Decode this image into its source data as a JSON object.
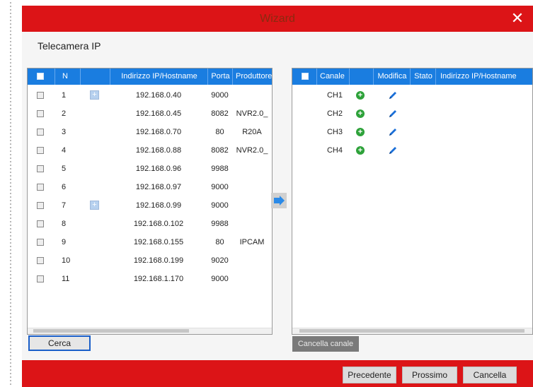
{
  "dialog": {
    "title": "Wizard",
    "close_glyph": "✕",
    "section_title": "Telecamera IP"
  },
  "left_table": {
    "columns": {
      "n": "N",
      "address": "Indirizzo IP/Hostname",
      "port": "Porta",
      "product": "Produttore"
    },
    "rows": [
      {
        "n": "1",
        "ip": "192.168.0.40",
        "port": "9000",
        "product": "",
        "addable": true
      },
      {
        "n": "2",
        "ip": "192.168.0.45",
        "port": "8082",
        "product": "NVR2.0_",
        "addable": false
      },
      {
        "n": "3",
        "ip": "192.168.0.70",
        "port": "80",
        "product": "R20A",
        "addable": false
      },
      {
        "n": "4",
        "ip": "192.168.0.88",
        "port": "8082",
        "product": "NVR2.0_",
        "addable": false
      },
      {
        "n": "5",
        "ip": "192.168.0.96",
        "port": "9988",
        "product": "",
        "addable": false
      },
      {
        "n": "6",
        "ip": "192.168.0.97",
        "port": "9000",
        "product": "",
        "addable": false
      },
      {
        "n": "7",
        "ip": "192.168.0.99",
        "port": "9000",
        "product": "",
        "addable": true
      },
      {
        "n": "8",
        "ip": "192.168.0.102",
        "port": "9988",
        "product": "",
        "addable": false
      },
      {
        "n": "9",
        "ip": "192.168.0.155",
        "port": "80",
        "product": "IPCAM",
        "addable": false
      },
      {
        "n": "10",
        "ip": "192.168.0.199",
        "port": "9020",
        "product": "",
        "addable": false
      },
      {
        "n": "11",
        "ip": "192.168.1.170",
        "port": "9000",
        "product": "",
        "addable": false
      }
    ]
  },
  "right_table": {
    "columns": {
      "channel": "Canale",
      "edit": "Modifica",
      "status": "Stato",
      "address": "Indirizzo IP/Hostname"
    },
    "rows": [
      {
        "channel": "CH1"
      },
      {
        "channel": "CH2"
      },
      {
        "channel": "CH3"
      },
      {
        "channel": "CH4"
      }
    ]
  },
  "buttons": {
    "search": "Cerca",
    "delete_channel": "Cancella canale",
    "previous": "Precedente",
    "next": "Prossimo",
    "cancel": "Cancella"
  },
  "icons": {
    "add_device": "add-to-channel-icon",
    "add_channel": "plus-circle-icon",
    "edit": "pencil-icon",
    "move_right": "arrow-right-icon",
    "close": "close-icon"
  },
  "colors": {
    "title_bar": "#dc1417",
    "table_header": "#1a7de0",
    "add_icon": "#2ea23a",
    "pencil": "#1a6fd8"
  }
}
